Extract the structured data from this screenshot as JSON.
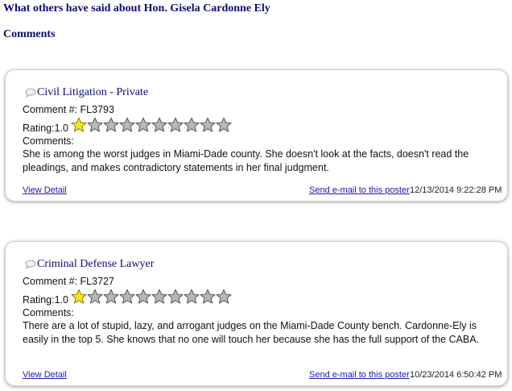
{
  "page": {
    "heading": "What others have said about Hon. Gisela Cardonne Ely",
    "comments_heading": "Comments"
  },
  "colors": {
    "heading": "#0d0d6e",
    "link": "#1a1aa6",
    "star_filled": "#f5e61a",
    "star_empty": "#b8b8b8"
  },
  "comments": [
    {
      "title": "Civil Litigation - Private",
      "comment_num": "Comment #: FL3793",
      "rating_label": "Rating:1.0",
      "rating_value": 1,
      "rating_max": 10,
      "comments_label": "Comments:",
      "text": "She is among the worst judges in Miami-Dade county. She doesn't look at the facts, doesn't read the pleadings, and makes contradictory statements in her final judgment.",
      "view_detail": "View Detail",
      "send_email": "Send e-mail to this poster",
      "date": "12/13/2014 9:22:28 PM"
    },
    {
      "title": "Criminal Defense Lawyer",
      "comment_num": "Comment #: FL3727",
      "rating_label": "Rating:1.0",
      "rating_value": 1,
      "rating_max": 10,
      "comments_label": "Comments:",
      "text": "There are a lot of stupid, lazy, and arrogant judges on the Miami-Dade County bench. Cardonne-Ely is easily in the top 5. She knows that no one will touch her because she has the full support of the CABA.",
      "view_detail": "View Detail",
      "send_email": "Send e-mail to this poster",
      "date": "10/23/2014 6:50:42 PM"
    }
  ]
}
